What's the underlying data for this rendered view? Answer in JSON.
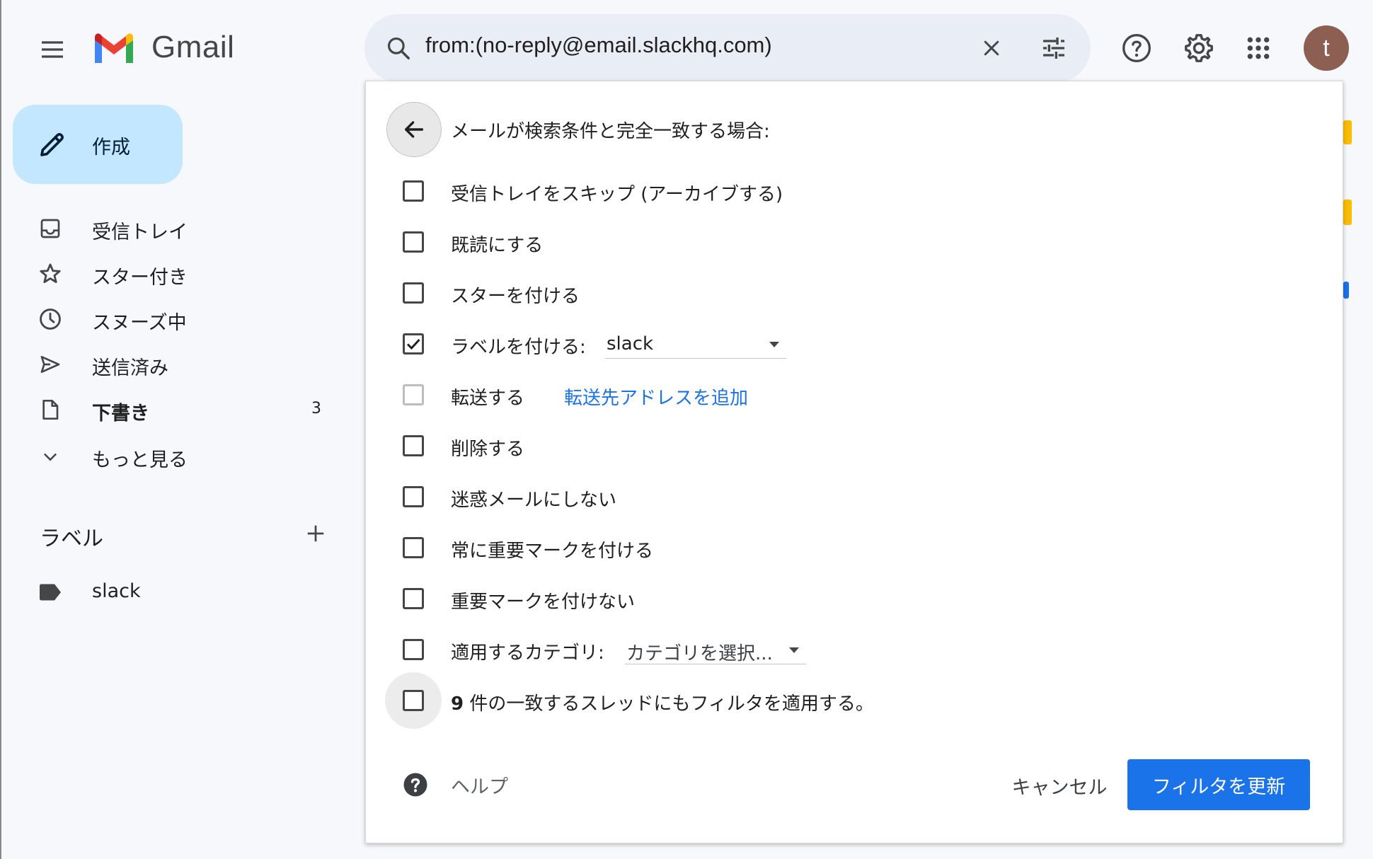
{
  "app": {
    "name": "Gmail"
  },
  "search": {
    "value": "from:(no-reply@email.slackhq.com)"
  },
  "account": {
    "avatar_letter": "t",
    "avatar_color": "#8d5e52"
  },
  "compose": {
    "label": "作成"
  },
  "nav": {
    "inbox": "受信トレイ",
    "starred": "スター付き",
    "snoozed": "スヌーズ中",
    "sent": "送信済み",
    "drafts": "下書き",
    "drafts_count": "3",
    "more": "もっと見る"
  },
  "labels": {
    "heading": "ラベル",
    "items": [
      {
        "name": "slack"
      }
    ]
  },
  "filter": {
    "header": "メールが検索条件と完全一致する場合:",
    "options": {
      "skip_inbox": {
        "label": "受信トレイをスキップ (アーカイブする)",
        "checked": false
      },
      "mark_read": {
        "label": "既読にする",
        "checked": false
      },
      "star": {
        "label": "スターを付ける",
        "checked": false
      },
      "apply_label": {
        "label": "ラベルを付ける:",
        "checked": true,
        "selected": "slack"
      },
      "forward": {
        "label": "転送する",
        "checked": false,
        "disabled": true,
        "link": "転送先アドレスを追加"
      },
      "delete": {
        "label": "削除する",
        "checked": false
      },
      "never_spam": {
        "label": "迷惑メールにしない",
        "checked": false
      },
      "always_important": {
        "label": "常に重要マークを付ける",
        "checked": false
      },
      "never_important": {
        "label": "重要マークを付けない",
        "checked": false
      },
      "category": {
        "label": "適用するカテゴリ:",
        "checked": false,
        "selected": "カテゴリを選択..."
      },
      "apply_existing": {
        "count": "9",
        "label": " 件の一致するスレッドにもフィルタを適用する。",
        "checked": false
      }
    },
    "help": "ヘルプ",
    "cancel": "キャンセル",
    "submit": "フィルタを更新"
  },
  "colors": {
    "accent": "#1a73e8",
    "compose_bg": "#c2e7ff",
    "search_bg": "#e9eef6",
    "page_bg": "#f6f8fc"
  }
}
